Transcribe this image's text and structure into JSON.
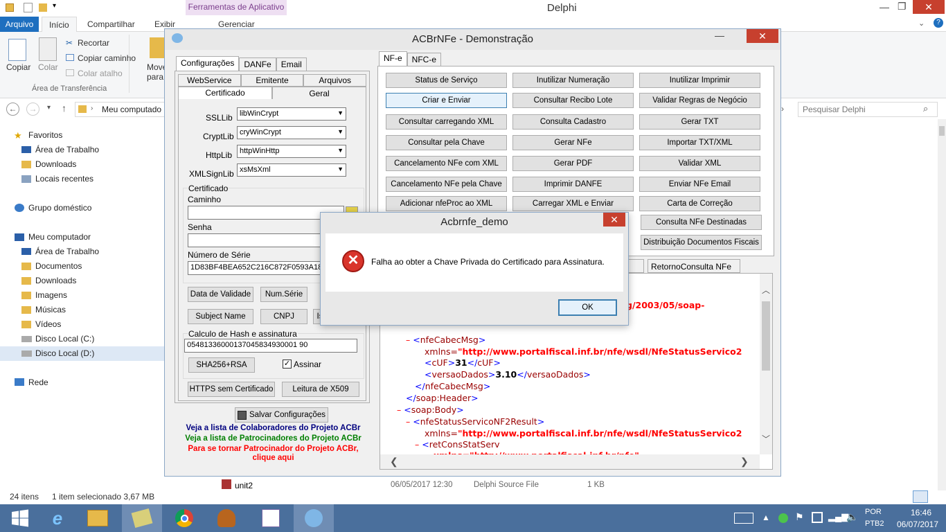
{
  "explorer": {
    "title": "Delphi",
    "ribbon_tabs": {
      "file": "Arquivo",
      "home": "Início",
      "share": "Compartilhar",
      "view": "Exibir",
      "context_band": "Ferramentas de Aplicativo",
      "manage": "Gerenciar"
    },
    "ribbon": {
      "copy": "Copiar",
      "paste": "Colar",
      "cut": "Recortar",
      "copy_path": "Copiar caminho",
      "paste_shortcut": "Colar atalho",
      "move": "Move",
      "move2": "para",
      "group": "Área de Transferência"
    },
    "address": "Meu computado",
    "search_placeholder": "Pesquisar Delphi",
    "nav": {
      "favorites": "Favoritos",
      "fav_items": [
        "Área de Trabalho",
        "Downloads",
        "Locais recentes"
      ],
      "homegroup": "Grupo doméstico",
      "computer": "Meu computador",
      "pc_items": [
        "Área de Trabalho",
        "Documentos",
        "Downloads",
        "Imagens",
        "Músicas",
        "Vídeos",
        "Disco Local (C:)",
        "Disco Local (D:)"
      ],
      "network": "Rede"
    },
    "file_row": {
      "name": "unit2",
      "date": "06/05/2017 12:30",
      "type": "Delphi Source File",
      "size": "1 KB"
    },
    "status": {
      "count": "24 itens",
      "selected": "1 item selecionado  3,67 MB"
    }
  },
  "acbr": {
    "title": "ACBrNFe - Demonstração",
    "left_tabs": [
      "Configurações",
      "DANFe",
      "Email"
    ],
    "sub_tabs_row1": [
      "WebService",
      "Emitente",
      "Arquivos"
    ],
    "sub_tabs_row2": [
      "Certificado",
      "Geral"
    ],
    "fields": {
      "ssllib_label": "SSLLib",
      "ssllib": "libWinCrypt",
      "cryptlib_label": "CryptLib",
      "cryptlib": "cryWinCrypt",
      "httplib_label": "HttpLib",
      "httplib": "httpWinHttp",
      "xmlsign_label": "XMLSignLib",
      "xmlsign": "xsMsXml",
      "cert_group": "Certificado",
      "path_label": "Caminho",
      "password_label": "Senha",
      "serial_label": "Número de Série",
      "serial": "1D83BF4BEA652C216C872F0593A183"
    },
    "cert_buttons": [
      "Data de Validade",
      "Num.Série",
      "Subject Name",
      "CNPJ",
      "Is"
    ],
    "hash_group": "Calculo de Hash e assinatura",
    "hash_value": "05481336000137045834930001 90",
    "sha_button": "SHA256+RSA",
    "sign_label": "Assinar",
    "https_button": "HTTPS sem Certificado",
    "x509_button": "Leitura de X509",
    "save_button": "Salvar Configurações",
    "links": [
      "Veja a lista de Colaboradores do Projeto ACBr",
      "Veja a lista de Patrocinadores do Projeto ACBr",
      "Para se tornar Patrocinador do Projeto ACBr,",
      "clique aqui"
    ],
    "right_tabs": [
      "NF-e",
      "NFC-e"
    ],
    "buttons": [
      [
        "Status de Serviço",
        "Inutilizar Numeração",
        "Inutilizar Imprimir"
      ],
      [
        "Criar e Enviar",
        "Consultar Recibo Lote",
        "Validar Regras de Negócio"
      ],
      [
        "Consultar carregando XML",
        "Consulta Cadastro",
        "Gerar TXT"
      ],
      [
        "Consultar pela Chave",
        "Gerar NFe",
        "Importar TXT/XML"
      ],
      [
        "Cancelamento NFe com XML",
        "Gerar PDF",
        "Validar XML"
      ],
      [
        "Cancelamento NFe pela Chave",
        "Imprimir DANFE",
        "Enviar NFe Email"
      ],
      [
        "Adicionar nfeProc ao XML",
        "Carregar XML e Enviar",
        "Carta de Correção"
      ]
    ],
    "extra_buttons": [
      "Consulta NFe Destinadas",
      "Distribuição Documentos Fiscais"
    ],
    "resp_tabs": [
      "ados",
      "RetornoConsulta NFe 2.01"
    ],
    "xml_lines": {
      "l0": "g/2003/05/soap-",
      "l1_tag": "nfeCabecMsg",
      "l2_attr": "xmlns=",
      "l2_val": "\"http://www.portalfiscal.inf.br/nfe/wsdl/NfeStatusServico2",
      "l3_tag": "cUF",
      "l3_val": "31",
      "l4_tag": "versaoDados",
      "l4_val": "3.10",
      "l5": "nfeCabecMsg",
      "l6": "soap:Header",
      "l7": "soap:Body",
      "l8": "nfeStatusServicoNF2Result",
      "l9_val": "\"http://www.portalfiscal.inf.br/nfe/wsdl/NfeStatusServico2",
      "l10": "retConsStatServ",
      "l11": "xmlns=\"http://www.portalfiscal.inf.br/nfe\""
    }
  },
  "dialog": {
    "title": "Acbrnfe_demo",
    "message": "Falha ao obter a Chave Privada do Certificado para Assinatura.",
    "ok": "OK"
  },
  "tray": {
    "lang1": "POR",
    "lang2": "PTB2",
    "time": "16:46",
    "date": "06/07/2017"
  }
}
